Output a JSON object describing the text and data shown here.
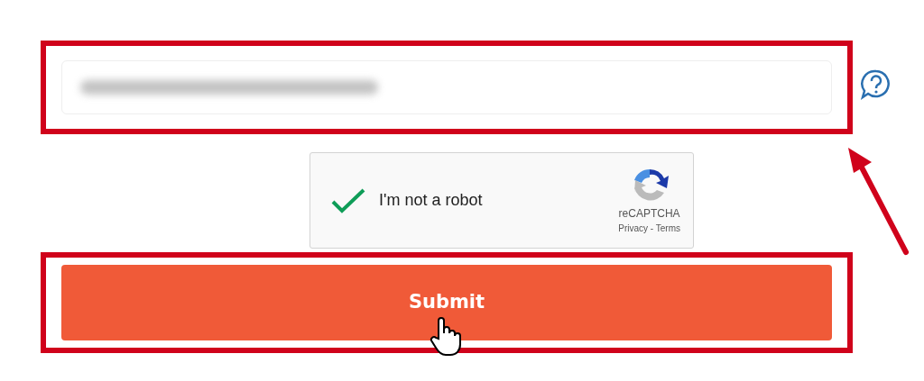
{
  "email_field": {
    "value_blurred": true
  },
  "captcha": {
    "checked": true,
    "label": "I'm not a robot",
    "brand": "reCAPTCHA",
    "privacy": "Privacy",
    "separator": "-",
    "terms": "Terms"
  },
  "submit_button": {
    "label": "Submit"
  }
}
